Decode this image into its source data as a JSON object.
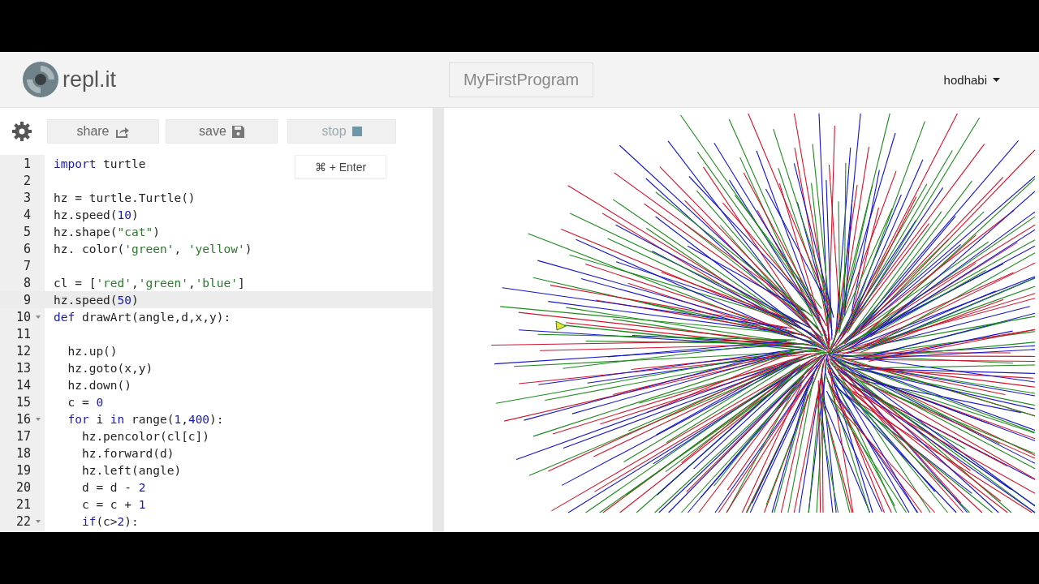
{
  "header": {
    "logo_text": "repl.it",
    "project_name": "MyFirstProgram",
    "user": "hodhabi"
  },
  "toolbar": {
    "buttons": [
      {
        "label": "share",
        "kind": "share",
        "hover": false
      },
      {
        "label": "save",
        "kind": "save",
        "hover": false
      },
      {
        "label": "stop",
        "kind": "stop",
        "hover": true
      }
    ],
    "tooltip": "⌘ + Enter"
  },
  "editor": {
    "lines": [
      {
        "number": "1",
        "fold": false,
        "current": false,
        "tokens": [
          {
            "kind": "keyword",
            "text": "import"
          },
          {
            "kind": "plain",
            "text": " turtle"
          }
        ]
      },
      {
        "number": "2",
        "fold": false,
        "current": false
      },
      {
        "number": "3",
        "fold": false,
        "current": false,
        "tokens": [
          {
            "kind": "plain",
            "text": "hz = turtle.Turtle()"
          }
        ]
      },
      {
        "number": "4",
        "fold": false,
        "current": false,
        "tokens": [
          {
            "kind": "plain",
            "text": "hz.speed("
          },
          {
            "kind": "number",
            "text": "10"
          },
          {
            "kind": "plain",
            "text": ")"
          }
        ]
      },
      {
        "number": "5",
        "fold": false,
        "current": false,
        "tokens": [
          {
            "kind": "plain",
            "text": "hz.shape("
          },
          {
            "kind": "string",
            "text": "\"cat\""
          },
          {
            "kind": "plain",
            "text": ")"
          }
        ]
      },
      {
        "number": "6",
        "fold": false,
        "current": false,
        "tokens": [
          {
            "kind": "plain",
            "text": "hz. color("
          },
          {
            "kind": "string",
            "text": "'green'"
          },
          {
            "kind": "plain",
            "text": ", "
          },
          {
            "kind": "string",
            "text": "'yellow'"
          },
          {
            "kind": "plain",
            "text": ")"
          }
        ]
      },
      {
        "number": "7",
        "fold": false,
        "current": false
      },
      {
        "number": "8",
        "fold": false,
        "current": false,
        "tokens": [
          {
            "kind": "plain",
            "text": "cl = ["
          },
          {
            "kind": "string",
            "text": "'red'"
          },
          {
            "kind": "plain",
            "text": ","
          },
          {
            "kind": "string",
            "text": "'green'"
          },
          {
            "kind": "plain",
            "text": ","
          },
          {
            "kind": "string",
            "text": "'blue'"
          },
          {
            "kind": "plain",
            "text": "]"
          }
        ]
      },
      {
        "number": "9",
        "fold": false,
        "current": true,
        "tokens": [
          {
            "kind": "plain",
            "text": "hz.speed("
          },
          {
            "kind": "number",
            "text": "50"
          },
          {
            "kind": "plain",
            "text": ")"
          }
        ]
      },
      {
        "number": "10",
        "fold": true,
        "current": false,
        "tokens": [
          {
            "kind": "keyword",
            "text": "def"
          },
          {
            "kind": "plain",
            "text": " drawArt(angle,d,x,y):"
          }
        ]
      },
      {
        "number": "11",
        "fold": false,
        "current": false
      },
      {
        "number": "12",
        "fold": false,
        "current": false,
        "tokens": [
          {
            "kind": "plain",
            "text": "  hz.up()"
          }
        ]
      },
      {
        "number": "13",
        "fold": false,
        "current": false,
        "tokens": [
          {
            "kind": "plain",
            "text": "  hz.goto(x,y)"
          }
        ]
      },
      {
        "number": "14",
        "fold": false,
        "current": false,
        "tokens": [
          {
            "kind": "plain",
            "text": "  hz.down()"
          }
        ]
      },
      {
        "number": "15",
        "fold": false,
        "current": false,
        "tokens": [
          {
            "kind": "plain",
            "text": "  c = "
          },
          {
            "kind": "number",
            "text": "0"
          }
        ]
      },
      {
        "number": "16",
        "fold": true,
        "current": false,
        "tokens": [
          {
            "kind": "keyword",
            "text": "  for"
          },
          {
            "kind": "plain",
            "text": " i "
          },
          {
            "kind": "keyword",
            "text": "in"
          },
          {
            "kind": "plain",
            "text": " range("
          },
          {
            "kind": "number",
            "text": "1"
          },
          {
            "kind": "plain",
            "text": ","
          },
          {
            "kind": "number",
            "text": "400"
          },
          {
            "kind": "plain",
            "text": "):"
          }
        ]
      },
      {
        "number": "17",
        "fold": false,
        "current": false,
        "tokens": [
          {
            "kind": "plain",
            "text": "    hz.pencolor(cl[c])"
          }
        ]
      },
      {
        "number": "18",
        "fold": false,
        "current": false,
        "tokens": [
          {
            "kind": "plain",
            "text": "    hz.forward(d)"
          }
        ]
      },
      {
        "number": "19",
        "fold": false,
        "current": false,
        "tokens": [
          {
            "kind": "plain",
            "text": "    hz.left(angle)"
          }
        ]
      },
      {
        "number": "20",
        "fold": false,
        "current": false,
        "tokens": [
          {
            "kind": "plain",
            "text": "    d = d - "
          },
          {
            "kind": "number",
            "text": "2"
          }
        ]
      },
      {
        "number": "21",
        "fold": false,
        "current": false,
        "tokens": [
          {
            "kind": "plain",
            "text": "    c = c + "
          },
          {
            "kind": "number",
            "text": "1"
          }
        ]
      },
      {
        "number": "22",
        "fold": true,
        "current": false,
        "tokens": [
          {
            "kind": "keyword",
            "text": "    if"
          },
          {
            "kind": "plain",
            "text": "(c>"
          },
          {
            "kind": "number",
            "text": "2"
          },
          {
            "kind": "plain",
            "text": "):"
          }
        ]
      }
    ]
  }
}
